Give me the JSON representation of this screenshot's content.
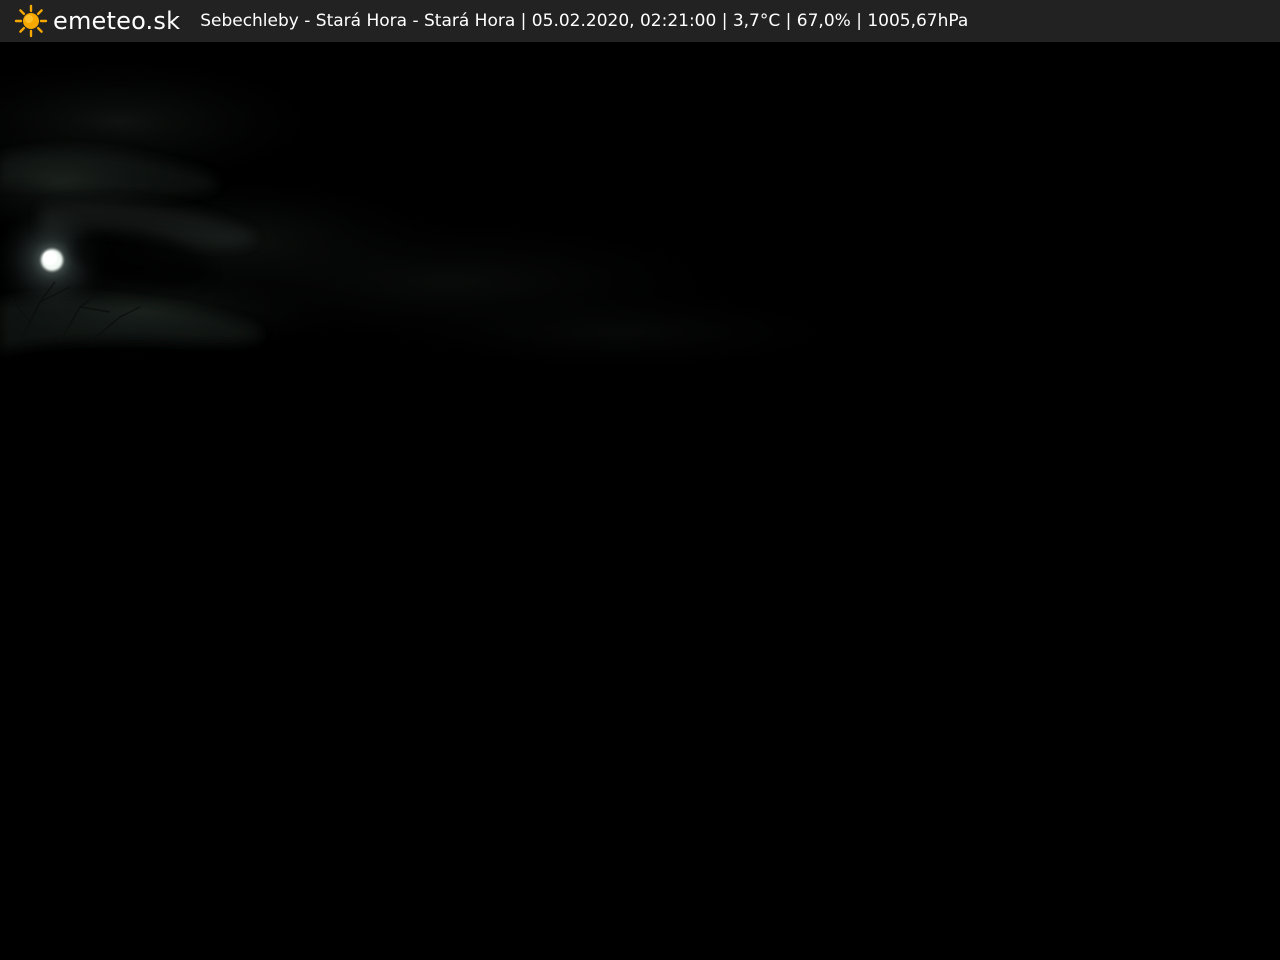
{
  "header": {
    "brand": "emeteo.sk",
    "logo_icon": "sun-icon",
    "caption": "Sebechleby - Stará Hora - Stará Hora | 05.02.2020, 02:21:00 | 3,7°C | 67,0% | 1005,67hPa"
  },
  "colors": {
    "bar_background": "#222222",
    "sun": "#f5a800",
    "sky": "#000000",
    "moon": "#f4fbf6"
  },
  "webcam": {
    "scene": "night sky with moon behind thin clouds"
  }
}
